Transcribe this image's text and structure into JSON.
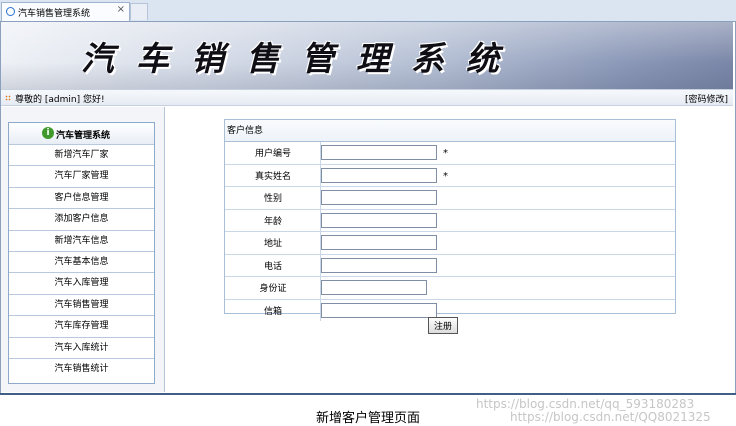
{
  "browser": {
    "tab_title": "汽车销售管理系统",
    "tab_close": "×"
  },
  "banner": {
    "title": "汽车销售管理系统"
  },
  "greeting_bar": {
    "greeting": "尊敬的 [admin] 您好!",
    "password_link": "[密码修改]"
  },
  "sidebar": {
    "title": "汽车管理系统",
    "info_icon_glyph": "i",
    "items": [
      {
        "label": "新增汽车厂家"
      },
      {
        "label": "汽车厂家管理"
      },
      {
        "label": "客户信息管理"
      },
      {
        "label": "添加客户信息"
      },
      {
        "label": "新增汽车信息"
      },
      {
        "label": "汽车基本信息"
      },
      {
        "label": "汽车入库管理"
      },
      {
        "label": "汽车销售管理"
      },
      {
        "label": "汽车库存管理"
      },
      {
        "label": "汽车入库统计"
      },
      {
        "label": "汽车销售统计"
      }
    ]
  },
  "form": {
    "title": "客户信息",
    "required_mark": "*",
    "fields": [
      {
        "label": "用户编号",
        "value": "",
        "required": true
      },
      {
        "label": "真实姓名",
        "value": "",
        "required": true
      },
      {
        "label": "性别",
        "value": "",
        "required": false
      },
      {
        "label": "年龄",
        "value": "",
        "required": false
      },
      {
        "label": "地址",
        "value": "",
        "required": false
      },
      {
        "label": "电话",
        "value": "",
        "required": false
      },
      {
        "label": "身份证",
        "value": "",
        "required": false
      },
      {
        "label": "信箱",
        "value": "",
        "required": false
      }
    ],
    "submit_label": "注册"
  },
  "caption": "新增客户管理页面",
  "watermark": {
    "line1": "https://blog.csdn.net/qq_593180283",
    "line2": "https://blog.csdn.net/QQ8021325"
  },
  "colors": {
    "accent": "#3f5f86",
    "border": "#8eaacb",
    "info_icon": "#3f9a2b"
  }
}
